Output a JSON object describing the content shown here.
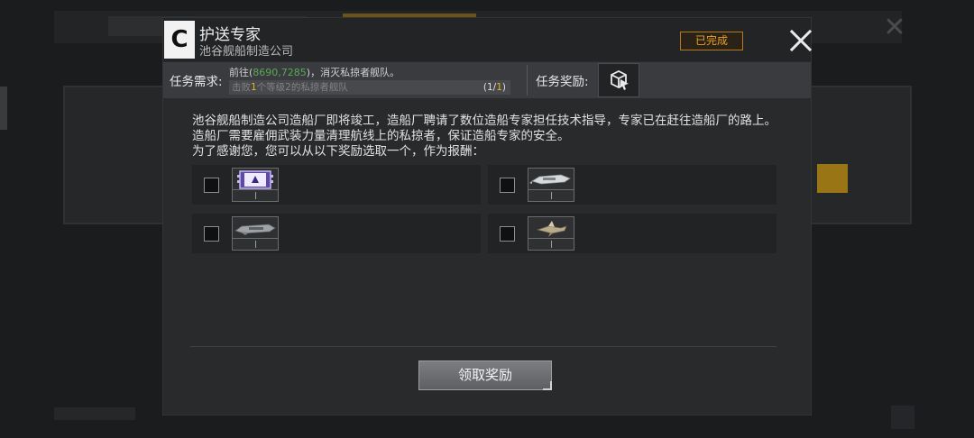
{
  "mission": {
    "title": "护送专家",
    "company": "池谷舰船制造公司",
    "logo_letter": "C",
    "status": "已完成",
    "close_icon": "close-icon"
  },
  "requirements": {
    "label": "任务需求:",
    "line1_prefix": "前往(",
    "coordinates": "8690,7285",
    "line1_suffix": ")，消灭私掠者舰队。",
    "objective_prefix": "击败",
    "objective_count": "1",
    "objective_suffix": "个等级2的私掠者舰队",
    "progress_open": "(1/",
    "progress_done": "1",
    "progress_close": ")"
  },
  "rewards_header": {
    "label": "任务奖励:",
    "icon": "box-cursor-icon"
  },
  "description": {
    "para1": "池谷舰船制造公司造船厂即将竣工，造船厂聘请了数位造船专家担任技术指导，专家已在赶往造船厂的路上。造船厂需要雇佣武装力量清理航线上的私掠者，保证造船专家的安全。",
    "para2": "为了感谢您，您可以从以下奖励选取一个，作为报酬："
  },
  "reward_options": [
    {
      "icon": "blueprint-chip-icon",
      "accent": "#7a5cc8"
    },
    {
      "icon": "white-frigate-icon",
      "accent": "#c9ccd0"
    },
    {
      "icon": "grey-cruiser-icon",
      "accent": "#9ea3a8"
    },
    {
      "icon": "tan-fighter-icon",
      "accent": "#b9ab8a"
    }
  ],
  "claim_button": "领取奖励",
  "colors": {
    "accent_gold": "#e0b52a",
    "status_orange": "#e8a12a",
    "coord_green": "#5aa858"
  }
}
